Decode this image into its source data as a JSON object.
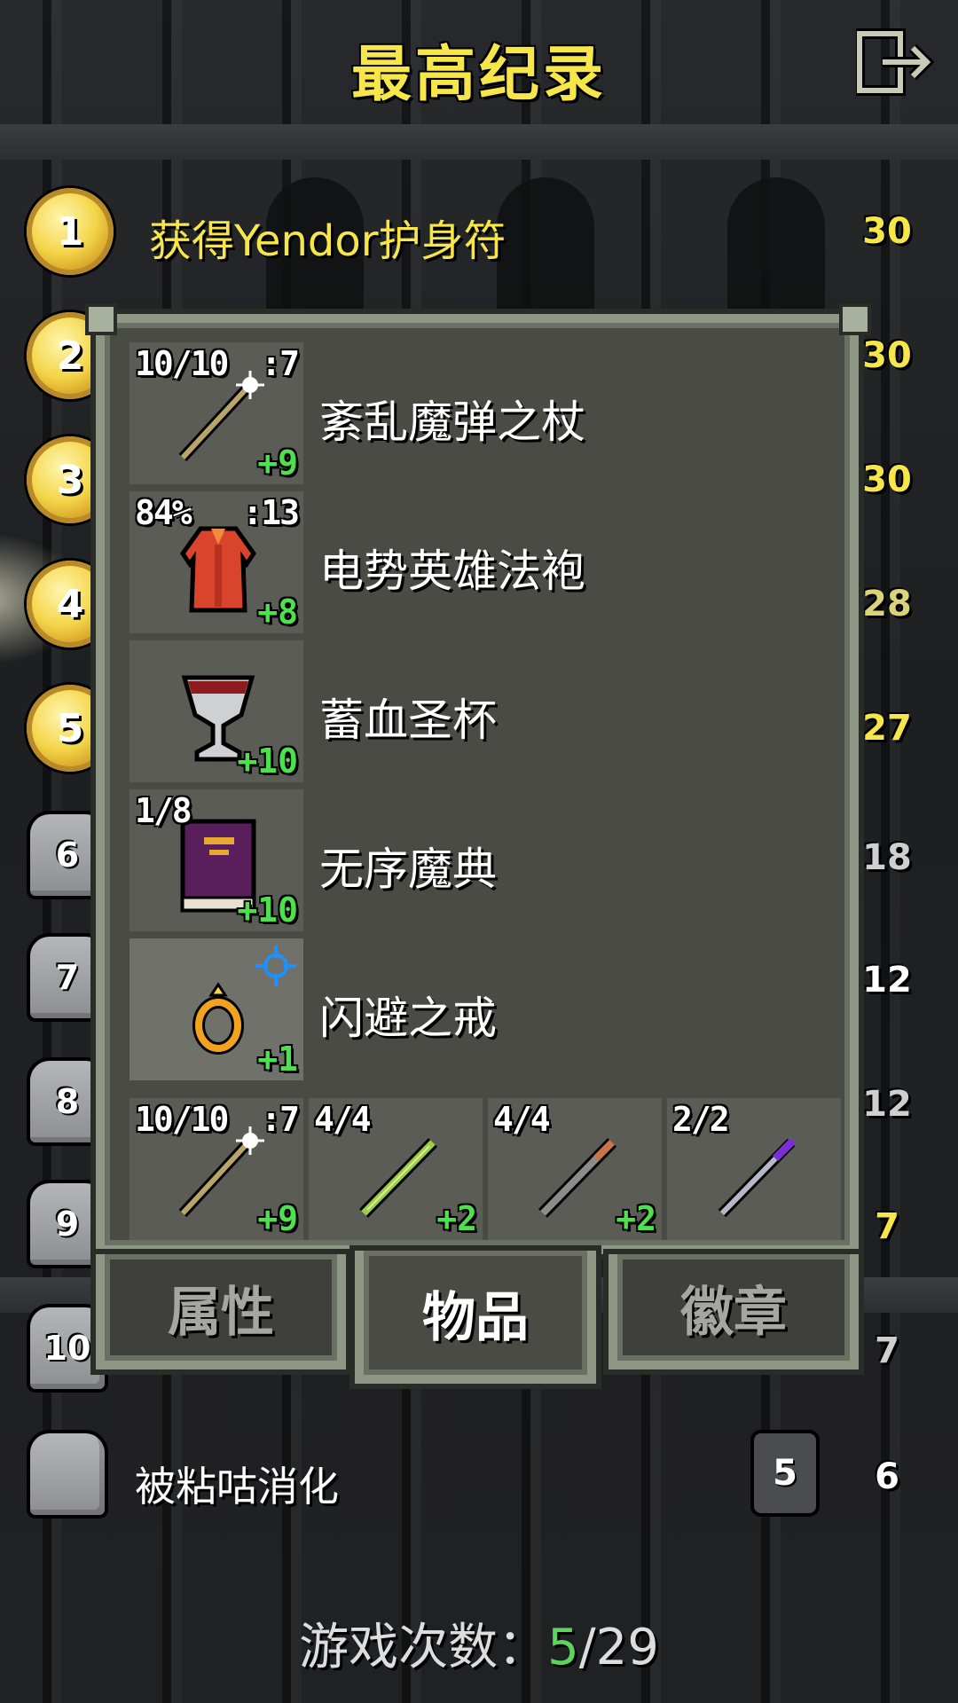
{
  "header": {
    "title": "最高纪录",
    "exit_icon": "exit-icon"
  },
  "records": [
    {
      "rank": "1",
      "type": "medal",
      "depth": "30",
      "description": "获得Yendor护身符"
    },
    {
      "rank": "2",
      "type": "medal",
      "depth": "30"
    },
    {
      "rank": "3",
      "type": "medal",
      "depth": "30"
    },
    {
      "rank": "4",
      "type": "medal",
      "depth": "28"
    },
    {
      "rank": "5",
      "type": "medal",
      "depth": "27"
    },
    {
      "rank": "6",
      "type": "tomb",
      "depth": "18"
    },
    {
      "rank": "7",
      "type": "tomb",
      "depth": "12"
    },
    {
      "rank": "8",
      "type": "tomb",
      "depth": "12"
    },
    {
      "rank": "9",
      "type": "tomb",
      "depth": "7"
    },
    {
      "rank": "10",
      "type": "tomb",
      "depth": "7"
    },
    {
      "rank": "",
      "type": "tomb",
      "depth": "6",
      "level": "5",
      "description": "被粘咕消化"
    }
  ],
  "dialog": {
    "items": [
      {
        "name": "紊乱魔弹之杖",
        "top_left": "10/10",
        "top_right": ":7",
        "upgrade": "+9",
        "icon": "wand-icon"
      },
      {
        "name": "电势英雄法袍",
        "top_left": "84%",
        "top_right": ":13",
        "upgrade": "+8",
        "icon": "robe-icon"
      },
      {
        "name": "蓄血圣杯",
        "top_left": "",
        "top_right": "",
        "upgrade": "+10",
        "icon": "chalice-icon"
      },
      {
        "name": "无序魔典",
        "top_left": "1/8",
        "top_right": "",
        "upgrade": "+10",
        "icon": "tome-icon"
      },
      {
        "name": "闪避之戒",
        "top_left": "",
        "top_right": "",
        "upgrade": "+1",
        "icon": "ring-icon"
      }
    ],
    "quickslots": [
      {
        "top_left": "10/10",
        "top_right": ":7",
        "upgrade": "+9",
        "icon": "wand-icon"
      },
      {
        "top_left": "4/4",
        "top_right": "",
        "upgrade": "+2",
        "icon": "green-wand-icon"
      },
      {
        "top_left": "4/4",
        "top_right": "",
        "upgrade": "+2",
        "icon": "copper-wand-icon"
      },
      {
        "top_left": "2/2",
        "top_right": "",
        "upgrade": "",
        "icon": "purple-wand-icon"
      }
    ],
    "tabs": [
      {
        "label": "属性",
        "active": false
      },
      {
        "label": "物品",
        "active": true
      },
      {
        "label": "徽章",
        "active": false
      }
    ]
  },
  "footer": {
    "label": "游戏次数：",
    "current": "5",
    "separator": "/",
    "total": "29"
  },
  "colors": {
    "title": "#f6e64a",
    "upgrade": "#4fe04f",
    "games_current": "#5dd45d"
  }
}
